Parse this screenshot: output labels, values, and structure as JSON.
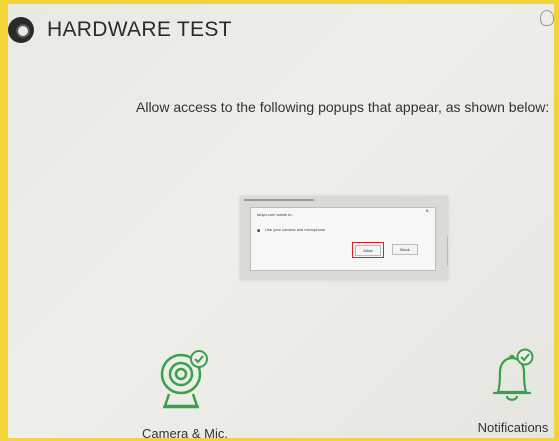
{
  "header": {
    "title": "HARDWARE TEST"
  },
  "instruction": "Allow access to the following popups that appear, as shown below:",
  "sample_popup": {
    "origin_text": "taoyo.com wants to:",
    "request_text": "Use your camera and microphone",
    "allow_label": "Allow",
    "block_label": "Block",
    "close_glyph": "×"
  },
  "features": {
    "camera_label": "Camera & Mic.",
    "notifications_label": "Notifications"
  },
  "colors": {
    "accent_green": "#3aa04a",
    "frame_yellow": "#f2d33a",
    "highlight_red": "#d42525"
  },
  "icons": [
    "app-logo-icon",
    "help-icon",
    "webcam-check-icon",
    "bell-check-icon",
    "microphone-icon",
    "close-icon"
  ]
}
